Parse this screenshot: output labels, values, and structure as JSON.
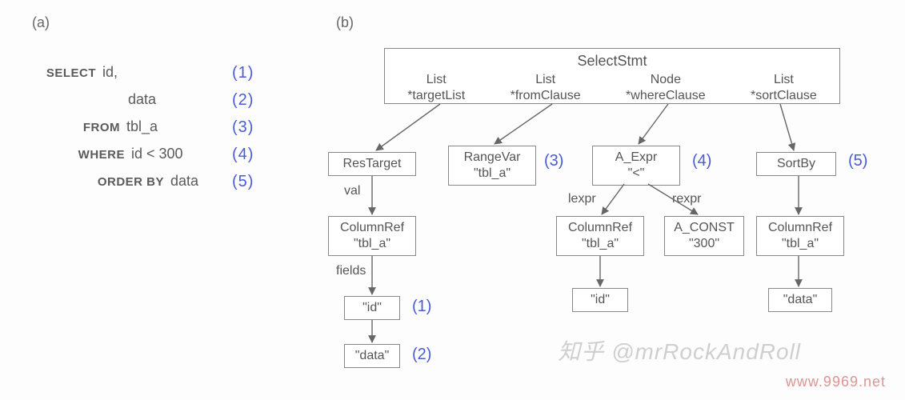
{
  "panels": {
    "a": "(a)",
    "b": "(b)"
  },
  "sql": {
    "rows": [
      {
        "kw": "SELECT",
        "txt": "id,",
        "num": "(1)"
      },
      {
        "kw": "",
        "txt": "data",
        "num": "(2)"
      },
      {
        "kw": "FROM",
        "txt": "tbl_a",
        "num": "(3)"
      },
      {
        "kw": "WHERE",
        "txt": "id < 300",
        "num": "(4)"
      },
      {
        "kw": "ORDER BY",
        "txt": "data",
        "num": "(5)"
      }
    ]
  },
  "tree": {
    "root": {
      "title": "SelectStmt",
      "members": [
        {
          "type": "List",
          "name": "*targetList"
        },
        {
          "type": "List",
          "name": "*fromClause"
        },
        {
          "type": "Node",
          "name": "*whereClause"
        },
        {
          "type": "List",
          "name": "*sortClause"
        }
      ]
    },
    "nodes": {
      "restarget": {
        "title": "ResTarget"
      },
      "colref1": {
        "title": "ColumnRef",
        "sub": "\"tbl_a\""
      },
      "id1": {
        "sub": "\"id\""
      },
      "data1": {
        "sub": "\"data\""
      },
      "rangevar": {
        "title": "RangeVar",
        "sub": "\"tbl_a\""
      },
      "aexpr": {
        "title": "A_Expr",
        "sub": "\"<\""
      },
      "colref2": {
        "title": "ColumnRef",
        "sub": "\"tbl_a\""
      },
      "aconst": {
        "title": "A_CONST",
        "sub": "\"300\""
      },
      "id2": {
        "sub": "\"id\""
      },
      "sortby": {
        "title": "SortBy"
      },
      "colref3": {
        "title": "ColumnRef",
        "sub": "\"tbl_a\""
      },
      "data2": {
        "sub": "\"data\""
      }
    },
    "edgeLabels": {
      "val": "val",
      "fields": "fields",
      "lexpr": "lexpr",
      "rexpr": "rexpr"
    },
    "tags": {
      "t1": "(1)",
      "t2": "(2)",
      "t3": "(3)",
      "t4": "(4)",
      "t5": "(5)"
    }
  },
  "watermarks": {
    "w1": "知乎 @mrRockAndRoll",
    "w2": "www.9969.net"
  }
}
